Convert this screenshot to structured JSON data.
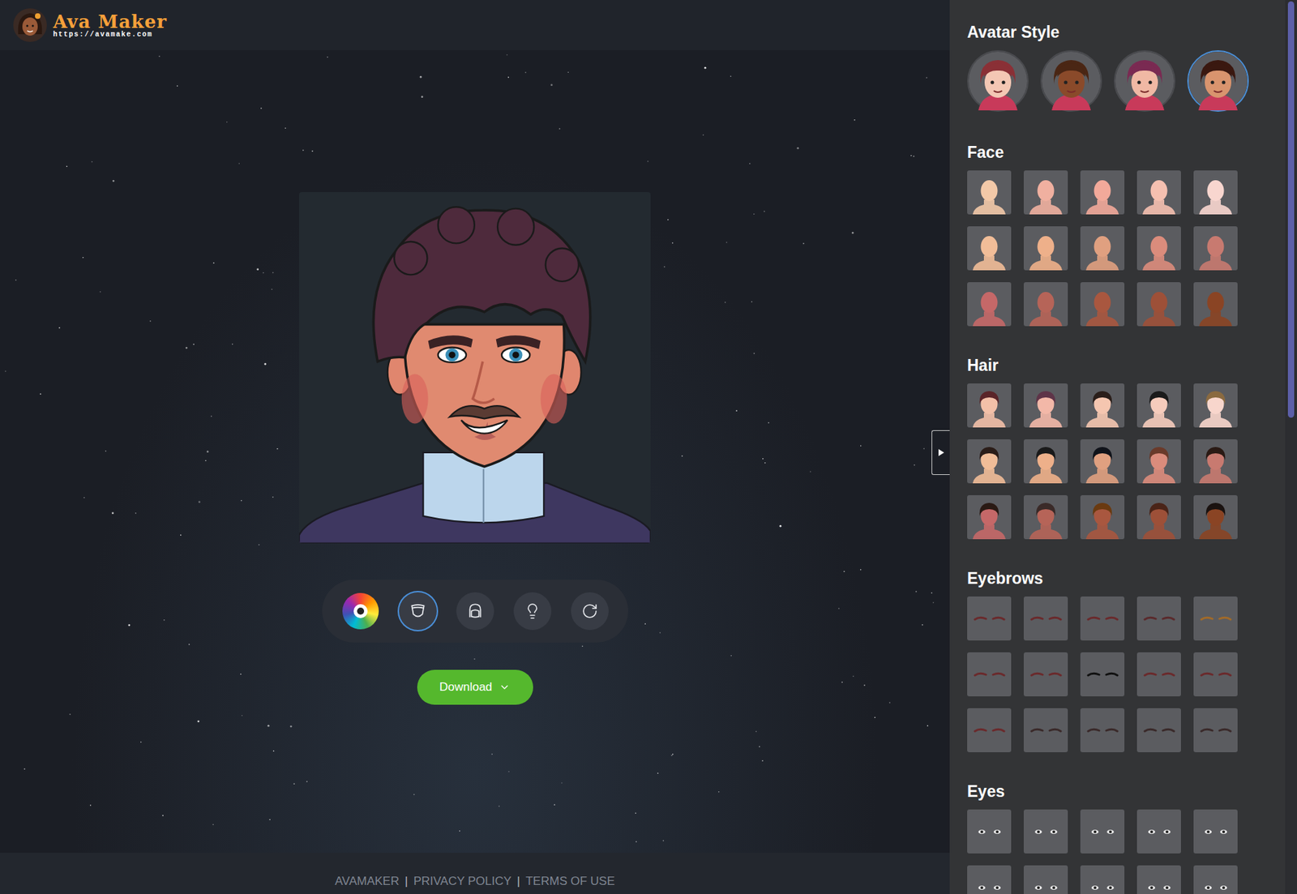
{
  "header": {
    "title": "Ava Maker",
    "url": "https://avamake.com"
  },
  "panel_title": "Avatar Style",
  "styles": [
    {
      "selected": false,
      "skin": "#f4c7b4",
      "hair": "#8a3036"
    },
    {
      "selected": false,
      "skin": "#8a4a2a",
      "hair": "#4a2614"
    },
    {
      "selected": false,
      "skin": "#f0b8a4",
      "hair": "#7a2a52"
    },
    {
      "selected": true,
      "skin": "#d9946e",
      "hair": "#3a1810"
    }
  ],
  "sections": [
    {
      "title": "Face",
      "kind": "face",
      "items": [
        {
          "selected": false,
          "color": "#f3c9a8"
        },
        {
          "selected": false,
          "color": "#f0b0a0"
        },
        {
          "selected": false,
          "color": "#f2a99a"
        },
        {
          "selected": false,
          "color": "#f5c0b0"
        },
        {
          "selected": false,
          "color": "#f8d6cf"
        },
        {
          "selected": false,
          "color": "#f1bd98"
        },
        {
          "selected": false,
          "color": "#eeb08a"
        },
        {
          "selected": false,
          "color": "#e0a080"
        },
        {
          "selected": false,
          "color": "#db8c7c"
        },
        {
          "selected": false,
          "color": "#c87a70"
        },
        {
          "selected": false,
          "color": "#c56868"
        },
        {
          "selected": false,
          "color": "#b66458"
        },
        {
          "selected": false,
          "color": "#a9573f"
        },
        {
          "selected": false,
          "color": "#9d5038"
        },
        {
          "selected": false,
          "color": "#8a4424"
        }
      ]
    },
    {
      "title": "Hair",
      "kind": "hair",
      "items": [
        {
          "selected": false,
          "color": "#5a2428",
          "skin": "#f3c0a8"
        },
        {
          "selected": false,
          "color": "#5e3448",
          "skin": "#f3b8a8"
        },
        {
          "selected": false,
          "color": "#2a1e1a",
          "skin": "#f5c6b0"
        },
        {
          "selected": false,
          "color": "#1a1a1a",
          "skin": "#f6ccbc"
        },
        {
          "selected": false,
          "color": "#8a6a40",
          "skin": "#f8d6cc"
        },
        {
          "selected": false,
          "color": "#2b1d18",
          "skin": "#f1bd98"
        },
        {
          "selected": false,
          "color": "#1a1a1a",
          "skin": "#eeb08a"
        },
        {
          "selected": false,
          "color": "#10131a",
          "skin": "#e0a080"
        },
        {
          "selected": false,
          "color": "#6a3a2a",
          "skin": "#db8c7c"
        },
        {
          "selected": false,
          "color": "#2a1a14",
          "skin": "#c87a70"
        },
        {
          "selected": false,
          "color": "#2a1a14",
          "skin": "#c56868"
        },
        {
          "selected": false,
          "color": "#3a2a28",
          "skin": "#b66458"
        },
        {
          "selected": false,
          "color": "#6a3a10",
          "skin": "#a9573f"
        },
        {
          "selected": false,
          "color": "#4a2418",
          "skin": "#9d5038"
        },
        {
          "selected": false,
          "color": "#1a1210",
          "skin": "#8a4424"
        }
      ]
    },
    {
      "title": "Eyebrows",
      "kind": "eyebrows",
      "items": [
        {
          "selected": false,
          "color": "#6a2a2c"
        },
        {
          "selected": false,
          "color": "#6a2a2c"
        },
        {
          "selected": false,
          "color": "#6a2a2c"
        },
        {
          "selected": false,
          "color": "#5a2a2c"
        },
        {
          "selected": false,
          "color": "#a06a2a"
        },
        {
          "selected": false,
          "color": "#6a2a2c"
        },
        {
          "selected": false,
          "color": "#6a2a2c"
        },
        {
          "selected": false,
          "color": "#111111"
        },
        {
          "selected": false,
          "color": "#6a2a2c"
        },
        {
          "selected": false,
          "color": "#6a2a2c"
        },
        {
          "selected": false,
          "color": "#6a2a2c"
        },
        {
          "selected": false,
          "color": "#3a2a2a"
        },
        {
          "selected": false,
          "color": "#3a2a2a"
        },
        {
          "selected": false,
          "color": "#3a2a2a"
        },
        {
          "selected": false,
          "color": "#3a2a2a"
        }
      ]
    },
    {
      "title": "Eyes",
      "kind": "eyes",
      "items": [
        {
          "selected": false
        },
        {
          "selected": false
        },
        {
          "selected": false
        },
        {
          "selected": false
        },
        {
          "selected": false
        },
        {
          "selected": false
        },
        {
          "selected": false
        },
        {
          "selected": false
        },
        {
          "selected": false
        },
        {
          "selected": false
        }
      ]
    }
  ],
  "tools": [
    {
      "kind": "colors",
      "selected": false
    },
    {
      "kind": "face",
      "selected": true
    },
    {
      "kind": "head",
      "selected": false
    },
    {
      "kind": "idea",
      "selected": false
    },
    {
      "kind": "reset",
      "selected": false
    }
  ],
  "download": {
    "label": "Download"
  },
  "footer": {
    "links": [
      "AVAMAKER",
      "PRIVACY POLICY",
      "TERMS OF USE"
    ],
    "separator": "|"
  }
}
